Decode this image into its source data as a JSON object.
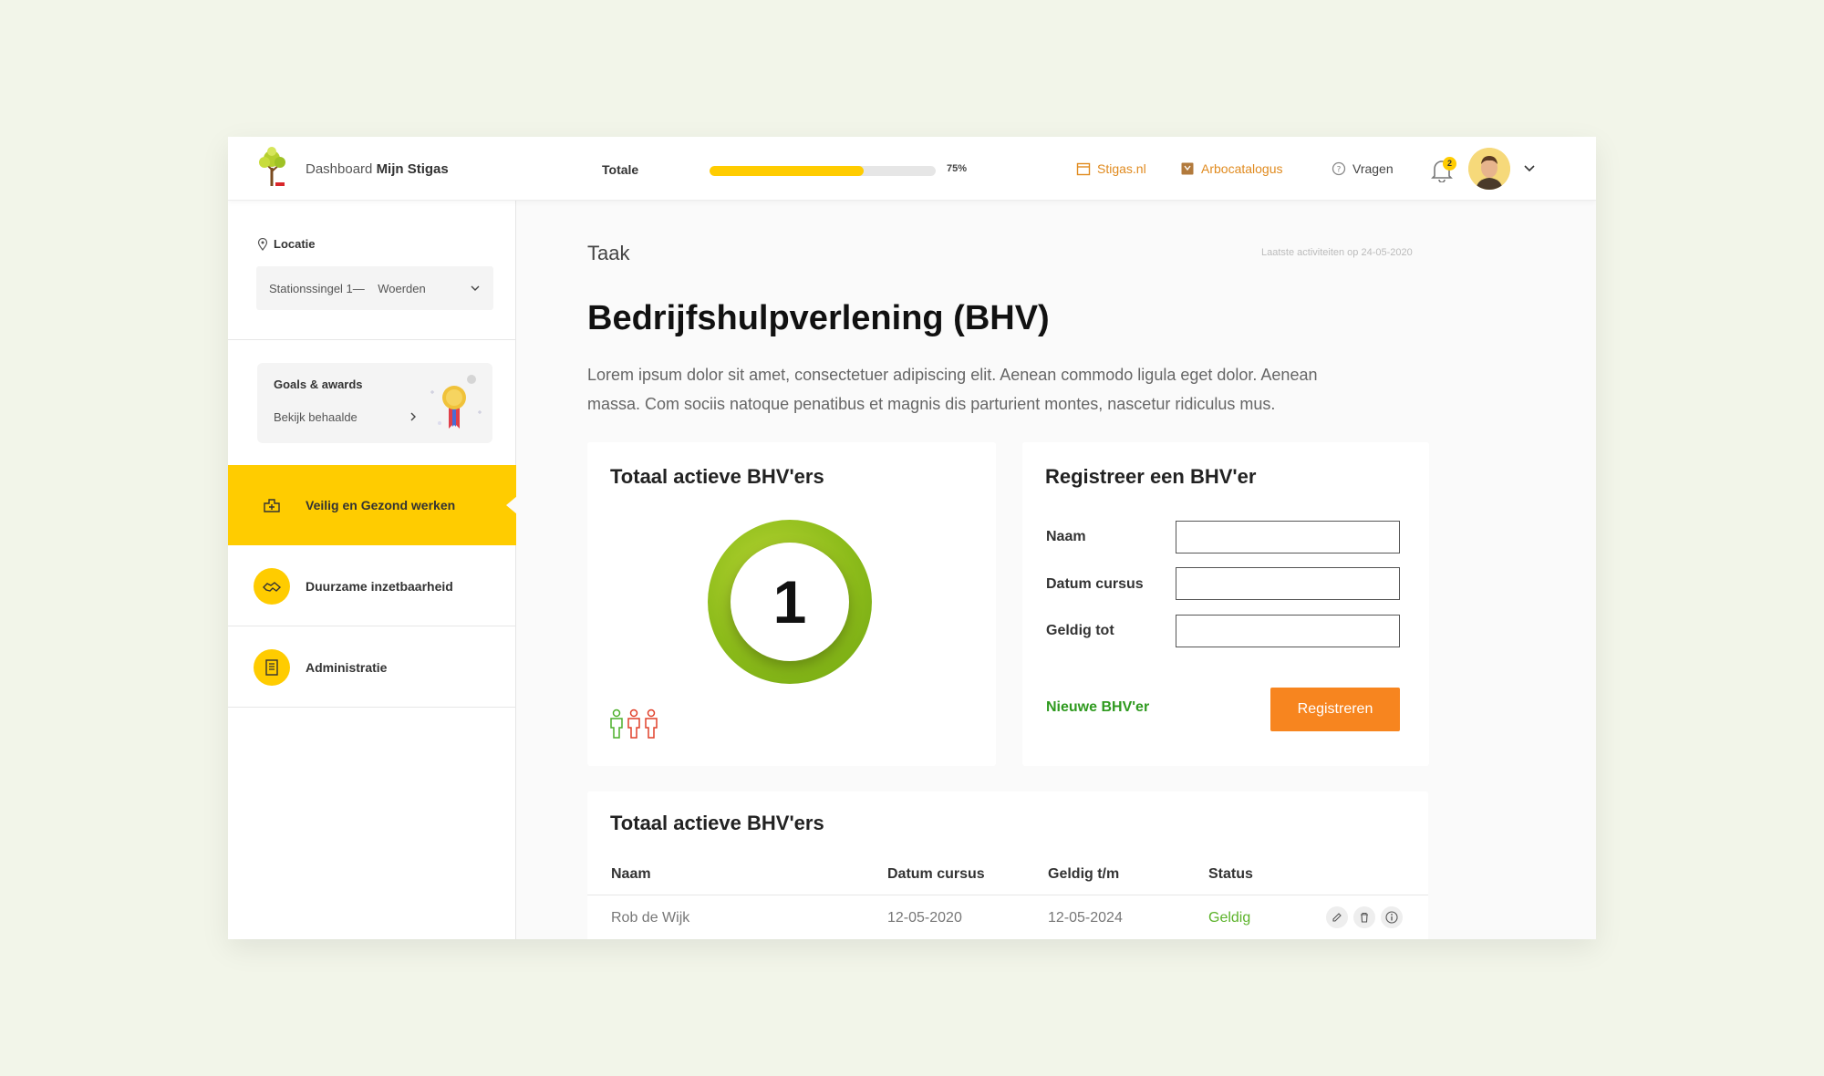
{
  "header": {
    "brand_prefix": "Dashboard",
    "brand_name": "Mijn Stigas",
    "progress_label": "Totale",
    "progress_value": 0.68,
    "progress_pct": "75%",
    "links": {
      "stigas": "Stigas.nl",
      "arbo": "Arbocatalogus",
      "vragen": "Vragen"
    },
    "notification_count": "2"
  },
  "sidebar": {
    "location_label": "Locatie",
    "location_value": "Stationssingel 1—    Woerden",
    "goals_title": "Goals & awards",
    "goals_link": "Bekijk behaalde",
    "nav": [
      {
        "label": "Veilig en Gezond werken",
        "active": true
      },
      {
        "label": "Duurzame inzetbaarheid",
        "active": false
      },
      {
        "label": "Administratie",
        "active": false
      }
    ]
  },
  "main": {
    "kicker": "Taak",
    "last_activity": "Laatste activiteiten op 24-05-2020",
    "title": "Bedrijfshulpverlening (BHV)",
    "description": "Lorem ipsum dolor sit amet, consectetuer adipiscing elit. Aenean commodo ligula eget dolor. Aenean massa. Com sociis natoque penatibus et magnis dis parturient montes, nascetur ridiculus mus."
  },
  "active_card": {
    "title": "Totaal actieve BHV'ers",
    "count": "1"
  },
  "register_card": {
    "title": "Registreer een BHV'er",
    "name_label": "Naam",
    "date_label": "Datum cursus",
    "valid_label": "Geldig tot",
    "new_link": "Nieuwe BHV'er",
    "submit": "Registreren"
  },
  "table": {
    "title": "Totaal actieve BHV'ers",
    "columns": [
      "Naam",
      "Datum cursus",
      "Geldig t/m",
      "Status"
    ],
    "rows": [
      {
        "name": "Rob de Wijk",
        "date": "12-05-2020",
        "valid": "12-05-2024",
        "status": "Geldig"
      }
    ]
  },
  "colors": {
    "accent": "#ffcc00",
    "cta": "#f7851f",
    "success": "#2f9a1f",
    "link": "#e08a1e"
  }
}
